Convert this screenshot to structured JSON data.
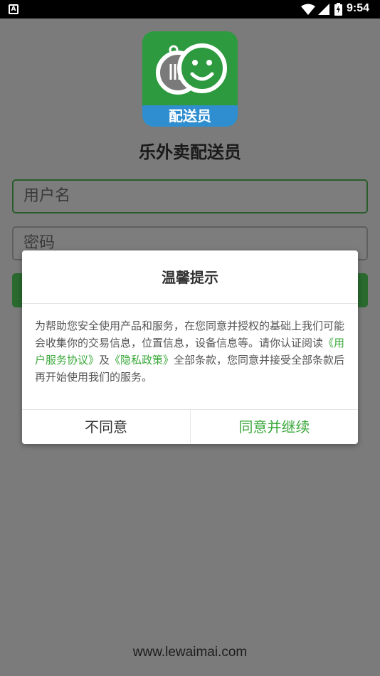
{
  "status_bar": {
    "time": "9:54",
    "notification_icon": "a-badge-icon",
    "wifi_icon": "wifi-icon",
    "signal_icon": "cell-signal-icon",
    "battery_icon": "battery-icon"
  },
  "app": {
    "logo_text": "配送员",
    "title": "乐外卖配送员",
    "username_placeholder": "用户名",
    "password_placeholder": "密码",
    "footer_url": "www.lewaimai.com",
    "brand_green": "#2e9a3f",
    "brand_blue": "#2f8ed0"
  },
  "dialog": {
    "title": "温馨提示",
    "body_part1": "为帮助您安全使用产品和服务，在您同意并授权的基础上我们可能会收集你的交易信息，位置信息，设备信息等。请你认证阅读",
    "link_user_agreement": "《用户服务协议》",
    "body_and": "及",
    "link_privacy_policy": "《隐私政策》",
    "body_part2": "全部条款，您同意并接受全部条款后再开始使用我们的服务。",
    "disagree_label": "不同意",
    "agree_label": "同意并继续",
    "accent_color": "#3aa83a"
  }
}
